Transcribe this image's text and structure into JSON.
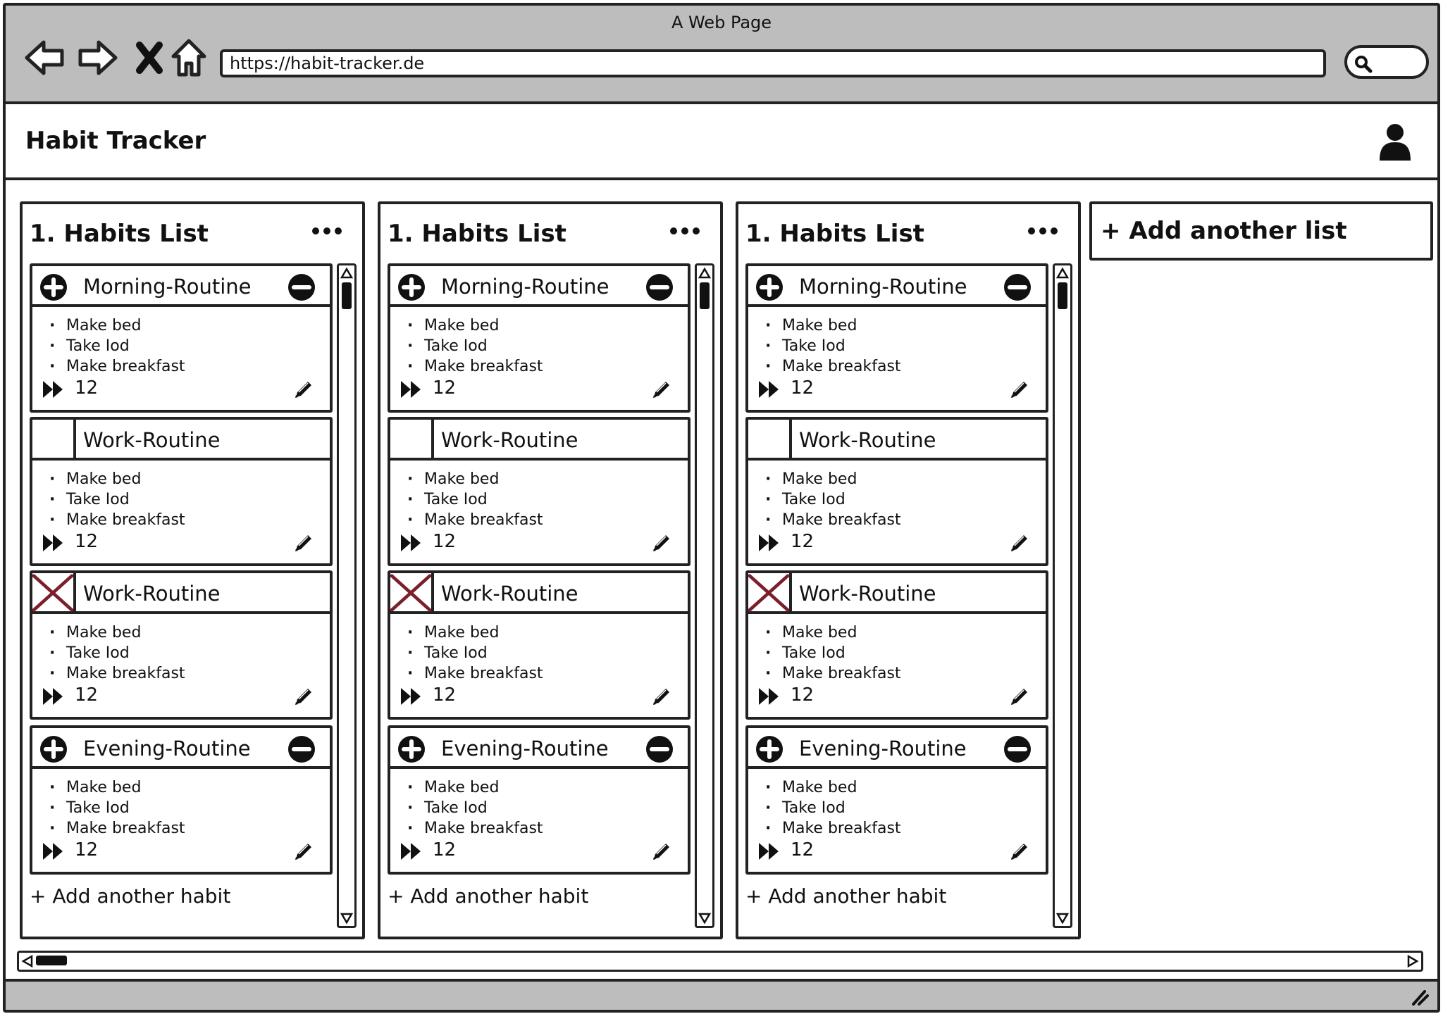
{
  "window": {
    "title": "A Web Page"
  },
  "browser": {
    "url": "https://habit-tracker.de",
    "icons": [
      "back-arrow-icon",
      "forward-arrow-icon",
      "close-x-icon",
      "home-icon",
      "search-icon"
    ]
  },
  "app": {
    "title": "Habit Tracker",
    "user_icon": "user-icon"
  },
  "lists": [
    {
      "title": "1. Habits List",
      "cards": [
        {
          "variant": "plus-minus",
          "title": "Morning-Routine",
          "items": [
            "Make bed",
            "Take Iod",
            "Make breakfast"
          ],
          "count": "12"
        },
        {
          "variant": "empty-box",
          "title": "Work-Routine",
          "items": [
            "Make bed",
            "Take Iod",
            "Make breakfast"
          ],
          "count": "12"
        },
        {
          "variant": "x-box",
          "title": "Work-Routine",
          "items": [
            "Make bed",
            "Take Iod",
            "Make breakfast"
          ],
          "count": "12"
        },
        {
          "variant": "plus-minus",
          "title": "Evening-Routine",
          "items": [
            "Make bed",
            "Take Iod",
            "Make breakfast"
          ],
          "count": "12"
        }
      ],
      "add_habit_label": "+ Add another habit"
    },
    {
      "title": "1. Habits List",
      "cards": [
        {
          "variant": "plus-minus",
          "title": "Morning-Routine",
          "items": [
            "Make bed",
            "Take Iod",
            "Make breakfast"
          ],
          "count": "12"
        },
        {
          "variant": "empty-box",
          "title": "Work-Routine",
          "items": [
            "Make bed",
            "Take Iod",
            "Make breakfast"
          ],
          "count": "12"
        },
        {
          "variant": "x-box",
          "title": "Work-Routine",
          "items": [
            "Make bed",
            "Take Iod",
            "Make breakfast"
          ],
          "count": "12"
        },
        {
          "variant": "plus-minus",
          "title": "Evening-Routine",
          "items": [
            "Make bed",
            "Take Iod",
            "Make breakfast"
          ],
          "count": "12"
        }
      ],
      "add_habit_label": "+ Add another habit"
    },
    {
      "title": "1. Habits List",
      "cards": [
        {
          "variant": "plus-minus",
          "title": "Morning-Routine",
          "items": [
            "Make bed",
            "Take Iod",
            "Make breakfast"
          ],
          "count": "12"
        },
        {
          "variant": "empty-box",
          "title": "Work-Routine",
          "items": [
            "Make bed",
            "Take Iod",
            "Make breakfast"
          ],
          "count": "12"
        },
        {
          "variant": "x-box",
          "title": "Work-Routine",
          "items": [
            "Make bed",
            "Take Iod",
            "Make breakfast"
          ],
          "count": "12"
        },
        {
          "variant": "plus-minus",
          "title": "Evening-Routine",
          "items": [
            "Make bed",
            "Take Iod",
            "Make breakfast"
          ],
          "count": "12"
        }
      ],
      "add_habit_label": "+ Add another habit"
    }
  ],
  "add_list_label": "+ Add another list",
  "colors": {
    "chrome": "#bdbdbd",
    "ink": "#222222",
    "x_mark": "#7a1f2b"
  }
}
